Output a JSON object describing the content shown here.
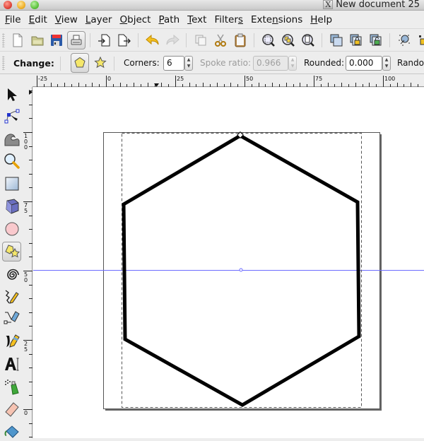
{
  "window": {
    "title": "New document 25",
    "x_icon": "X"
  },
  "menubar": {
    "items": [
      {
        "label": "File",
        "mnemonic": "F",
        "rest": "ile"
      },
      {
        "label": "Edit",
        "mnemonic": "E",
        "rest": "dit"
      },
      {
        "label": "View",
        "mnemonic": "V",
        "rest": "iew"
      },
      {
        "label": "Layer",
        "mnemonic": "L",
        "rest": "ayer"
      },
      {
        "label": "Object",
        "mnemonic": "O",
        "rest": "bject"
      },
      {
        "label": "Path",
        "mnemonic": "P",
        "rest": "ath"
      },
      {
        "label": "Text",
        "mnemonic": "T",
        "rest": "ext"
      },
      {
        "label": "Filters",
        "pre": "Filter",
        "mnemonic": "s",
        "rest": ""
      },
      {
        "label": "Extensions",
        "pre": "Exte",
        "mnemonic": "n",
        "rest": "sions"
      },
      {
        "label": "Help",
        "mnemonic": "H",
        "rest": "elp"
      }
    ]
  },
  "commands_bar": {
    "icons": [
      "new-document-icon",
      "open-icon",
      "save-icon",
      "print-icon",
      "import-icon",
      "export-icon",
      "undo-icon",
      "redo-icon",
      "duplicate-icon",
      "cut-icon",
      "paste-icon",
      "zoom-selection-icon",
      "zoom-drawing-icon",
      "zoom-page-icon",
      "group-icon",
      "lock-icon",
      "unlock-icon",
      "node-edit-icon"
    ]
  },
  "tool_controls": {
    "change_label": "Change:",
    "mode_polygon": "polygon",
    "mode_star": "star",
    "corners_label": "Corners:",
    "corners_value": "6",
    "spoke_ratio_label": "Spoke ratio:",
    "spoke_ratio_value": "0.966",
    "rounded_label": "Rounded:",
    "rounded_value": "0.000",
    "randomized_label": "Randor"
  },
  "rulers": {
    "top_labels": [
      "-25",
      "0",
      "25",
      "50",
      "75",
      "100"
    ],
    "left_labels": [
      "100",
      "75",
      "50",
      "25",
      "0"
    ]
  },
  "toolbox": {
    "tools": [
      {
        "name": "selector-tool",
        "active": false
      },
      {
        "name": "node-tool",
        "active": false
      },
      {
        "name": "tweak-tool",
        "active": false
      },
      {
        "name": "zoom-tool",
        "active": false
      },
      {
        "name": "rectangle-tool",
        "active": false
      },
      {
        "name": "3d-box-tool",
        "active": false
      },
      {
        "name": "ellipse-tool",
        "active": false
      },
      {
        "name": "star-polygon-tool",
        "active": true
      },
      {
        "name": "spiral-tool",
        "active": false
      },
      {
        "name": "pencil-tool",
        "active": false
      },
      {
        "name": "pen-tool",
        "active": false
      },
      {
        "name": "calligraphy-tool",
        "active": false
      },
      {
        "name": "text-tool",
        "active": false
      },
      {
        "name": "spray-tool",
        "active": false
      },
      {
        "name": "eraser-tool",
        "active": false
      },
      {
        "name": "paint-bucket-tool",
        "active": false
      }
    ]
  },
  "colors": {
    "guide": "#6b6bff",
    "stroke": "#000000",
    "page_border": "#555555"
  }
}
